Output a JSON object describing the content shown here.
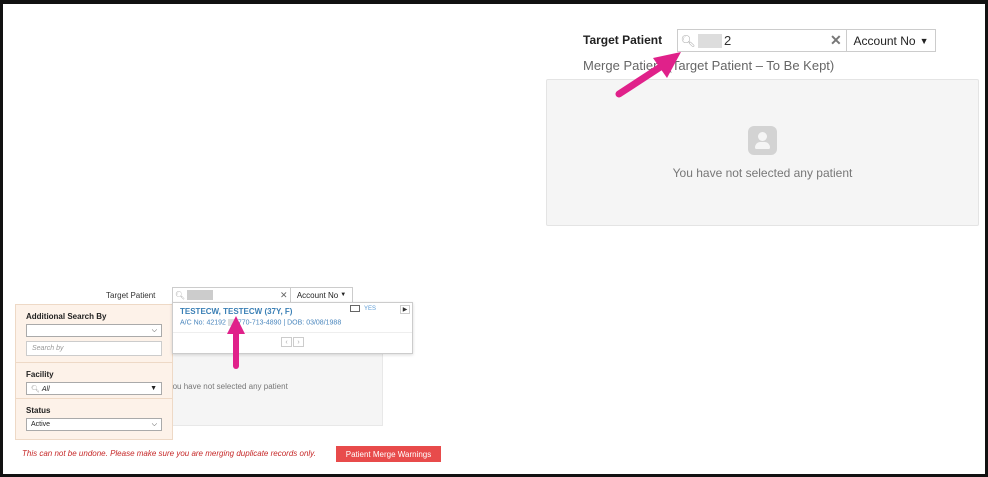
{
  "large_panel": {
    "target_label": "Target Patient",
    "search_value": "2",
    "select_value": "Account No",
    "section_title": "Merge Patient (Target Patient – To Be Kept)",
    "empty_text": "You have not selected any patient"
  },
  "small_panel": {
    "target_label": "Target Patient",
    "select_value": "Account No",
    "filters": {
      "additional_search_label": "Additional Search By",
      "additional_search_value": "",
      "search_by_placeholder": "Search by",
      "facility_label": "Facility",
      "facility_value": "All",
      "status_label": "Status",
      "status_value": "Active"
    },
    "result": {
      "name": "TESTECW, TESTECW (37Y, F)",
      "account_prefix": "A/C No: 42192",
      "phone_dob": "770-713-4890  |  DOB: 03/08/1988",
      "badge": "YES"
    },
    "empty_text": "You have not selected any patient"
  },
  "footer": {
    "warning_text": "This can not be undone. Please make sure you are merging duplicate records only.",
    "warnings_button": "Patient Merge Warnings"
  },
  "colors": {
    "annotation_arrow": "#e0218a",
    "link_blue": "#3a7fb5",
    "danger": "#e84b4b",
    "filter_bg": "#fdf2e9"
  }
}
